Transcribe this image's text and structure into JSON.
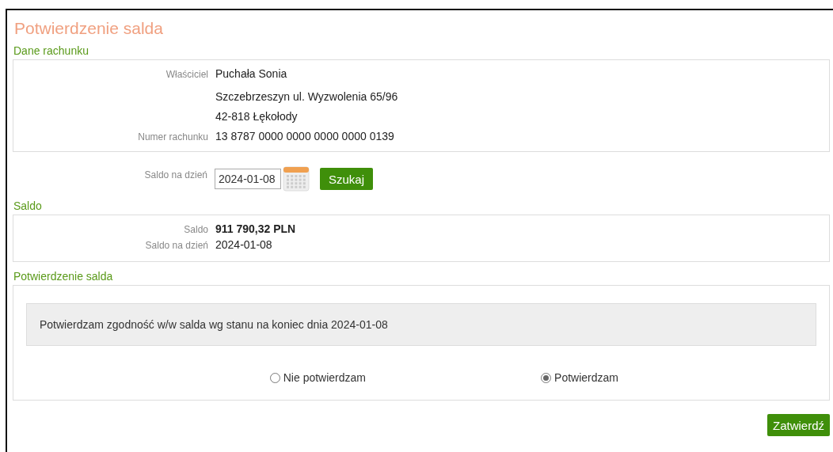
{
  "title": "Potwierdzenie salda",
  "account": {
    "heading": "Dane rachunku",
    "rows": [
      {
        "label": "Właściciel",
        "value": "Puchała Sonia"
      },
      {
        "value": "Szczebrzeszyn ul. Wyzwolenia 65/96"
      },
      {
        "value": "42-818 Łękołody"
      },
      {
        "label": "Numer rachunku",
        "value": "13 8787 0000 0000 0000 0000 0139"
      }
    ]
  },
  "date_filter": {
    "label": "Saldo na dzień",
    "value": "2024-01-08",
    "button": "Szukaj"
  },
  "balance": {
    "heading": "Saldo",
    "rows": [
      {
        "label": "Saldo",
        "value": "911 790,32 PLN",
        "bold": true
      },
      {
        "label": "Saldo na dzień",
        "value": "2024-01-08",
        "bold": false
      }
    ]
  },
  "confirmation": {
    "heading": "Potwierdzenie salda",
    "statement": "Potwierdzam zgodność w/w salda wg stanu na koniec dnia 2024-01-08",
    "options": [
      {
        "label": "Nie potwierdzam",
        "selected": false
      },
      {
        "label": "Potwierdzam",
        "selected": true
      }
    ]
  },
  "submit": "Zatwierdź"
}
